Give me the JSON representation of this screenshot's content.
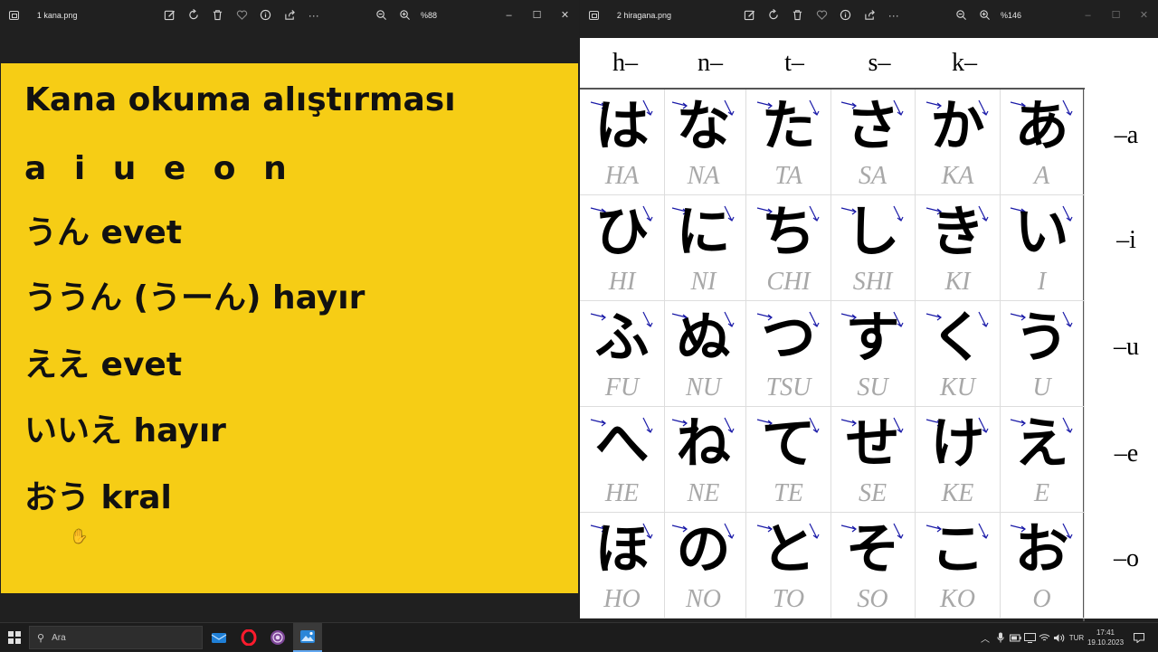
{
  "left_window": {
    "filename": "1 kana.png",
    "zoom": "%88",
    "slide": {
      "title": "Kana okuma alıştırması",
      "vowels": "a i u e o n",
      "lines": [
        "うん evet",
        "ううん (うーん) hayır",
        "ええ evet",
        "いいえ hayır",
        "おう kral"
      ]
    }
  },
  "right_window": {
    "filename": "2 hiragana.png",
    "zoom": "%146",
    "chart": {
      "col_headers": [
        "h–",
        "n–",
        "t–",
        "s–",
        "k–"
      ],
      "row_headers": [
        "–a",
        "–i",
        "–u",
        "–e",
        "–o"
      ],
      "rows": [
        [
          {
            "k": "は",
            "r": "HA"
          },
          {
            "k": "な",
            "r": "NA"
          },
          {
            "k": "た",
            "r": "TA"
          },
          {
            "k": "さ",
            "r": "SA"
          },
          {
            "k": "か",
            "r": "KA"
          },
          {
            "k": "あ",
            "r": "A"
          }
        ],
        [
          {
            "k": "ひ",
            "r": "HI"
          },
          {
            "k": "に",
            "r": "NI"
          },
          {
            "k": "ち",
            "r": "CHI"
          },
          {
            "k": "し",
            "r": "SHI"
          },
          {
            "k": "き",
            "r": "KI"
          },
          {
            "k": "い",
            "r": "I"
          }
        ],
        [
          {
            "k": "ふ",
            "r": "FU"
          },
          {
            "k": "ぬ",
            "r": "NU"
          },
          {
            "k": "つ",
            "r": "TSU"
          },
          {
            "k": "す",
            "r": "SU"
          },
          {
            "k": "く",
            "r": "KU"
          },
          {
            "k": "う",
            "r": "U"
          }
        ],
        [
          {
            "k": "へ",
            "r": "HE"
          },
          {
            "k": "ね",
            "r": "NE"
          },
          {
            "k": "て",
            "r": "TE"
          },
          {
            "k": "せ",
            "r": "SE"
          },
          {
            "k": "け",
            "r": "KE"
          },
          {
            "k": "え",
            "r": "E"
          }
        ],
        [
          {
            "k": "ほ",
            "r": "HO"
          },
          {
            "k": "の",
            "r": "NO"
          },
          {
            "k": "と",
            "r": "TO"
          },
          {
            "k": "そ",
            "r": "SO"
          },
          {
            "k": "こ",
            "r": "KO"
          },
          {
            "k": "お",
            "r": "O"
          }
        ]
      ]
    }
  },
  "toolbar_icons": [
    "edit-image-icon",
    "rotate-icon",
    "delete-icon",
    "favorite-icon",
    "info-icon",
    "share-icon",
    "more-icon"
  ],
  "taskbar": {
    "search_placeholder": "Ara",
    "language": "TUR",
    "time": "17:41",
    "date": "19.10.2023"
  },
  "colors": {
    "slide_bg": "#f6cd15",
    "titlebar_bg": "#202020",
    "stroke_arrow": "#1a1aa8",
    "romaji_gray": "#a8a8a8"
  }
}
